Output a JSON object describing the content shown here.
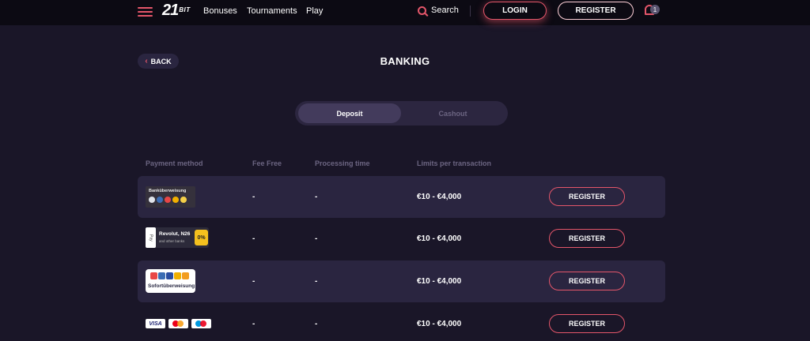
{
  "header": {
    "logo_main": "21",
    "logo_sub": "BIT",
    "nav": [
      "Bonuses",
      "Tournaments",
      "Play"
    ],
    "search_label": "Search",
    "login_label": "LOGIN",
    "register_label": "REGISTER",
    "notification_count": "1"
  },
  "page": {
    "back_label": "BACK",
    "title": "BANKING"
  },
  "tabs": {
    "deposit": "Deposit",
    "cashout": "Cashout",
    "active": "Deposit"
  },
  "table": {
    "headers": [
      "Payment method",
      "Fee Free",
      "Processing time",
      "Limits per transaction"
    ],
    "rows": [
      {
        "method": "Banküberweisung",
        "fee_free": "-",
        "processing": "-",
        "limits": "€10 - €4,000",
        "button": "REGISTER"
      },
      {
        "method_title": "Revolut, N26",
        "method_subtitle": "and other banks",
        "method_badge": "0%",
        "method_card": "Pay",
        "fee_free": "-",
        "processing": "-",
        "limits": "€10 - €4,000",
        "button": "REGISTER"
      },
      {
        "method": "Sofortüberweisung",
        "fee_free": "-",
        "processing": "-",
        "limits": "€10 - €4,000",
        "button": "REGISTER"
      },
      {
        "method": "VISA",
        "fee_free": "-",
        "processing": "-",
        "limits": "€10 - €4,000",
        "button": "REGISTER"
      }
    ]
  },
  "colors": {
    "accent": "#e4566a",
    "background": "#1a1628",
    "topbar": "#0c0a13",
    "row_shade": "#2a2540",
    "muted_text": "#6c6582"
  },
  "icons": {
    "menu": "hamburger-menu-icon",
    "search": "search-icon",
    "notifications": "bell-icon",
    "back": "chevron-left-icon"
  }
}
